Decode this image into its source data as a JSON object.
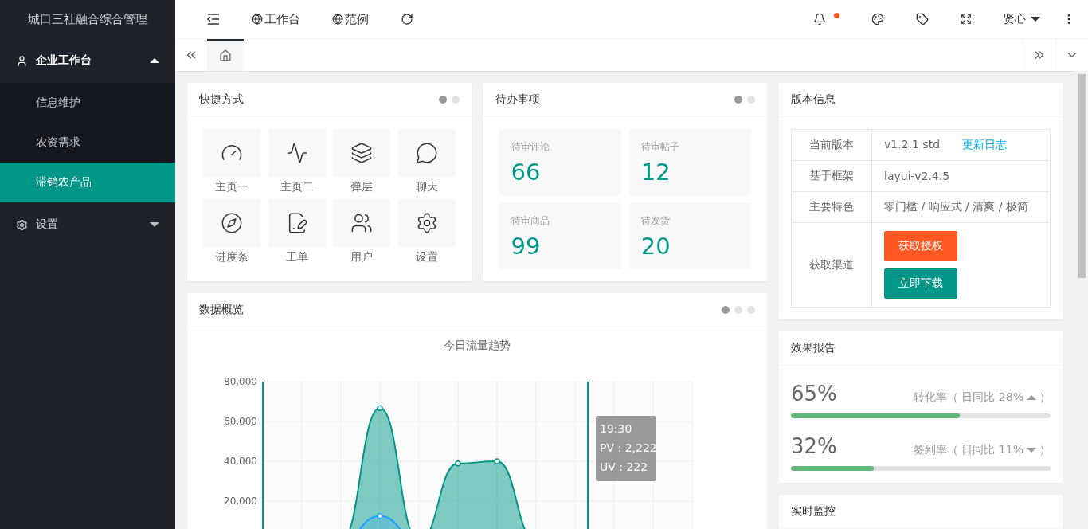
{
  "sidebar": {
    "title": "城口三社融合综合管理",
    "items": [
      {
        "label": "企业工作台",
        "expanded": true,
        "children": [
          {
            "label": "信息维护",
            "selected": false
          },
          {
            "label": "农资需求",
            "selected": false
          },
          {
            "label": "滞销农产品",
            "selected": true
          }
        ]
      },
      {
        "label": "设置",
        "expanded": false
      }
    ]
  },
  "header": {
    "nav": [
      "工作台",
      "范例"
    ],
    "notification_dot": true,
    "user": "贤心"
  },
  "tabs": [
    {
      "kind": "home",
      "selected": true
    }
  ],
  "shortcuts": {
    "title": "快捷方式",
    "pages": [
      {
        "selected": true
      },
      {
        "selected": false
      }
    ],
    "items": [
      "主页一",
      "主页二",
      "弹层",
      "聊天",
      "进度条",
      "工单",
      "用户",
      "设置"
    ]
  },
  "todo": {
    "title": "待办事项",
    "pages": [
      {
        "selected": true
      },
      {
        "selected": false
      }
    ],
    "items": [
      {
        "label": "待审评论",
        "value": "66"
      },
      {
        "label": "待审帖子",
        "value": "12"
      },
      {
        "label": "待审商品",
        "value": "99"
      },
      {
        "label": "待发货",
        "value": "20"
      }
    ]
  },
  "overview": {
    "title": "数据概览",
    "pages": [
      {
        "selected": true
      },
      {
        "selected": false
      },
      {
        "selected": false
      }
    ],
    "chart_data": {
      "type": "area",
      "title": "今日流量趋势",
      "grid": true,
      "ylim": [
        0,
        80000
      ],
      "yticks": [
        {
          "value": 20000,
          "label": "20,000"
        },
        {
          "value": 40000,
          "label": "40,000"
        },
        {
          "value": 60000,
          "label": "60,000"
        },
        {
          "value": 80000,
          "label": "80,000"
        }
      ],
      "series": [
        {
          "name": "PV",
          "color": "#009688",
          "values": [
            0,
            0,
            0,
            66700,
            0,
            38900,
            40000,
            0,
            0,
            0,
            0,
            0
          ]
        },
        {
          "name": "UV",
          "color": "#1e9fff",
          "values": [
            0,
            0,
            0,
            12500,
            0,
            0,
            0,
            0,
            0,
            0,
            0,
            0
          ]
        }
      ]
    },
    "tooltip": {
      "title": "19:30",
      "separator": " : ",
      "values": [
        "2,222",
        "222"
      ]
    }
  },
  "version": {
    "title": "版本信息",
    "rows": [
      {
        "kind": "text",
        "label": "当前版本",
        "value": "v1.2.1 std",
        "link": "更新日志"
      },
      {
        "kind": "text",
        "label": "基于框架",
        "value": "layui-v2.4.5"
      },
      {
        "kind": "text",
        "label": "主要特色",
        "value": "零门槛 / 响应式 / 清爽 / 极简"
      },
      {
        "kind": "buttons",
        "label": "获取渠道",
        "buttons": [
          "获取授权",
          "立即下载"
        ]
      }
    ]
  },
  "report": {
    "title": "效果报告",
    "items": [
      {
        "percent": "65%",
        "caption": "转化率（ 日同比 28%",
        "rising": true,
        "close": "）",
        "level": 0.65
      },
      {
        "percent": "32%",
        "caption": "签到率（ 日同比 11%",
        "rising": false,
        "close": "）",
        "level": 0.32
      }
    ]
  },
  "monitor": {
    "title": "实时监控"
  }
}
